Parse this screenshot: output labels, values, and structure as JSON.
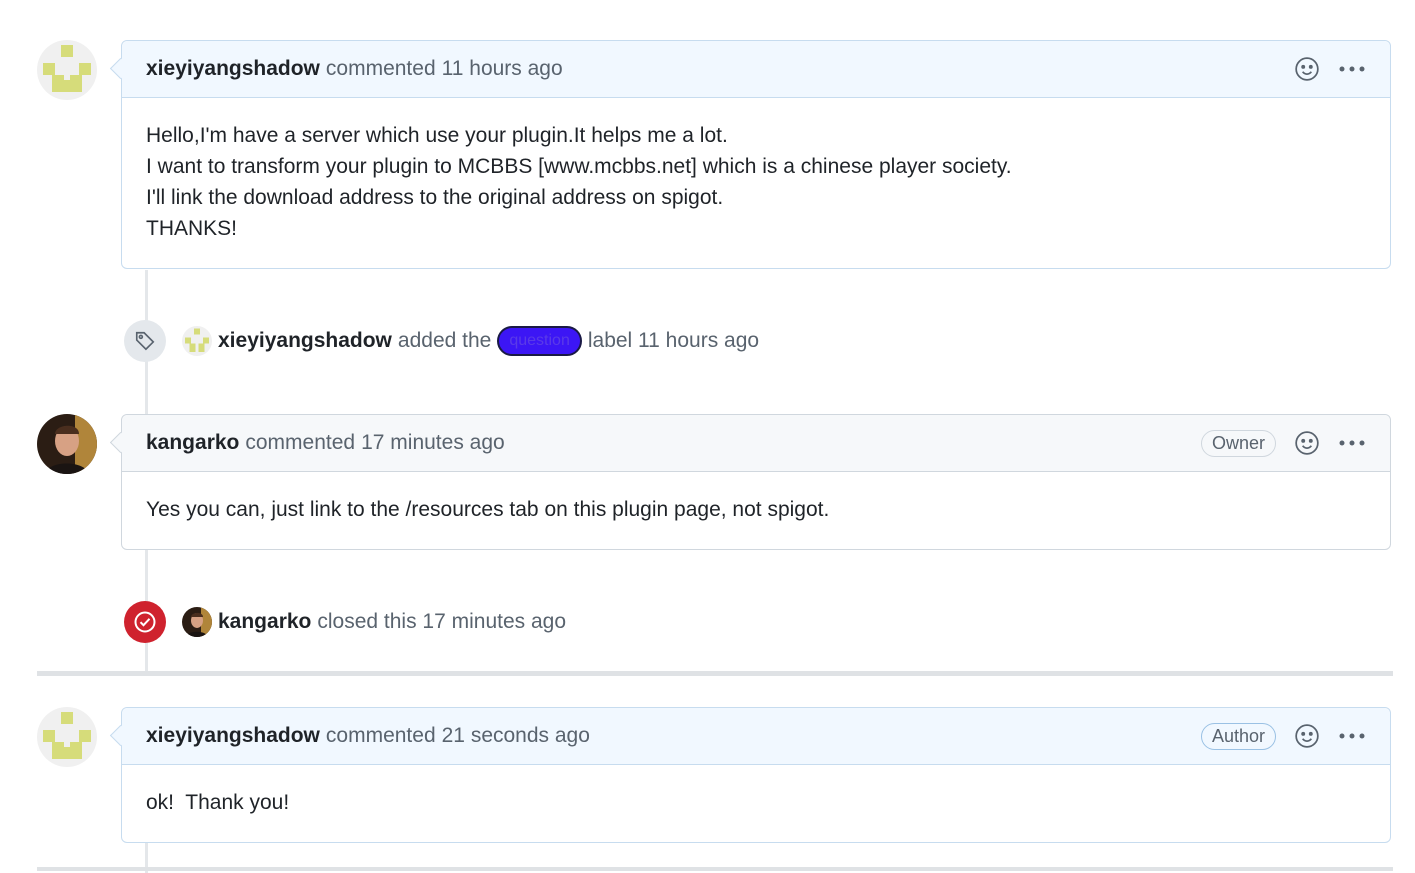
{
  "colors": {
    "accent_blue": "#f1f8ff",
    "label_question": "#3c16f5",
    "closed_red": "#cf222e"
  },
  "comments": [
    {
      "author": "xieyiyangshadow",
      "action": "commented",
      "time": "11 hours ago",
      "badge": "",
      "body": [
        "Hello,I'm have a server which use your plugin.It helps me a lot.",
        "I want to transform your plugin to MCBBS [www.mcbbs.net] which is a chinese player society.",
        "I'll link the download address to the original address on spigot.",
        "THANKS!"
      ]
    },
    {
      "author": "kangarko",
      "action": "commented",
      "time": "17 minutes ago",
      "badge": "Owner",
      "body": [
        "Yes you can, just link to the /resources tab on this plugin page, not spigot."
      ]
    },
    {
      "author": "xieyiyangshadow",
      "action": "commented",
      "time": "21 seconds ago",
      "badge": "Author",
      "body": [
        "ok!  Thank you!"
      ]
    }
  ],
  "events": {
    "label_event": {
      "actor": "xieyiyangshadow",
      "text_before": "added the",
      "label": "question",
      "text_after": "label 11 hours ago",
      "icon": "tag-icon"
    },
    "closed_event": {
      "actor": "kangarko",
      "text": "closed this 17 minutes ago",
      "icon": "check-circle-icon"
    }
  },
  "icons": {
    "reaction": "smiley-icon",
    "menu": "kebab-horizontal-icon"
  }
}
